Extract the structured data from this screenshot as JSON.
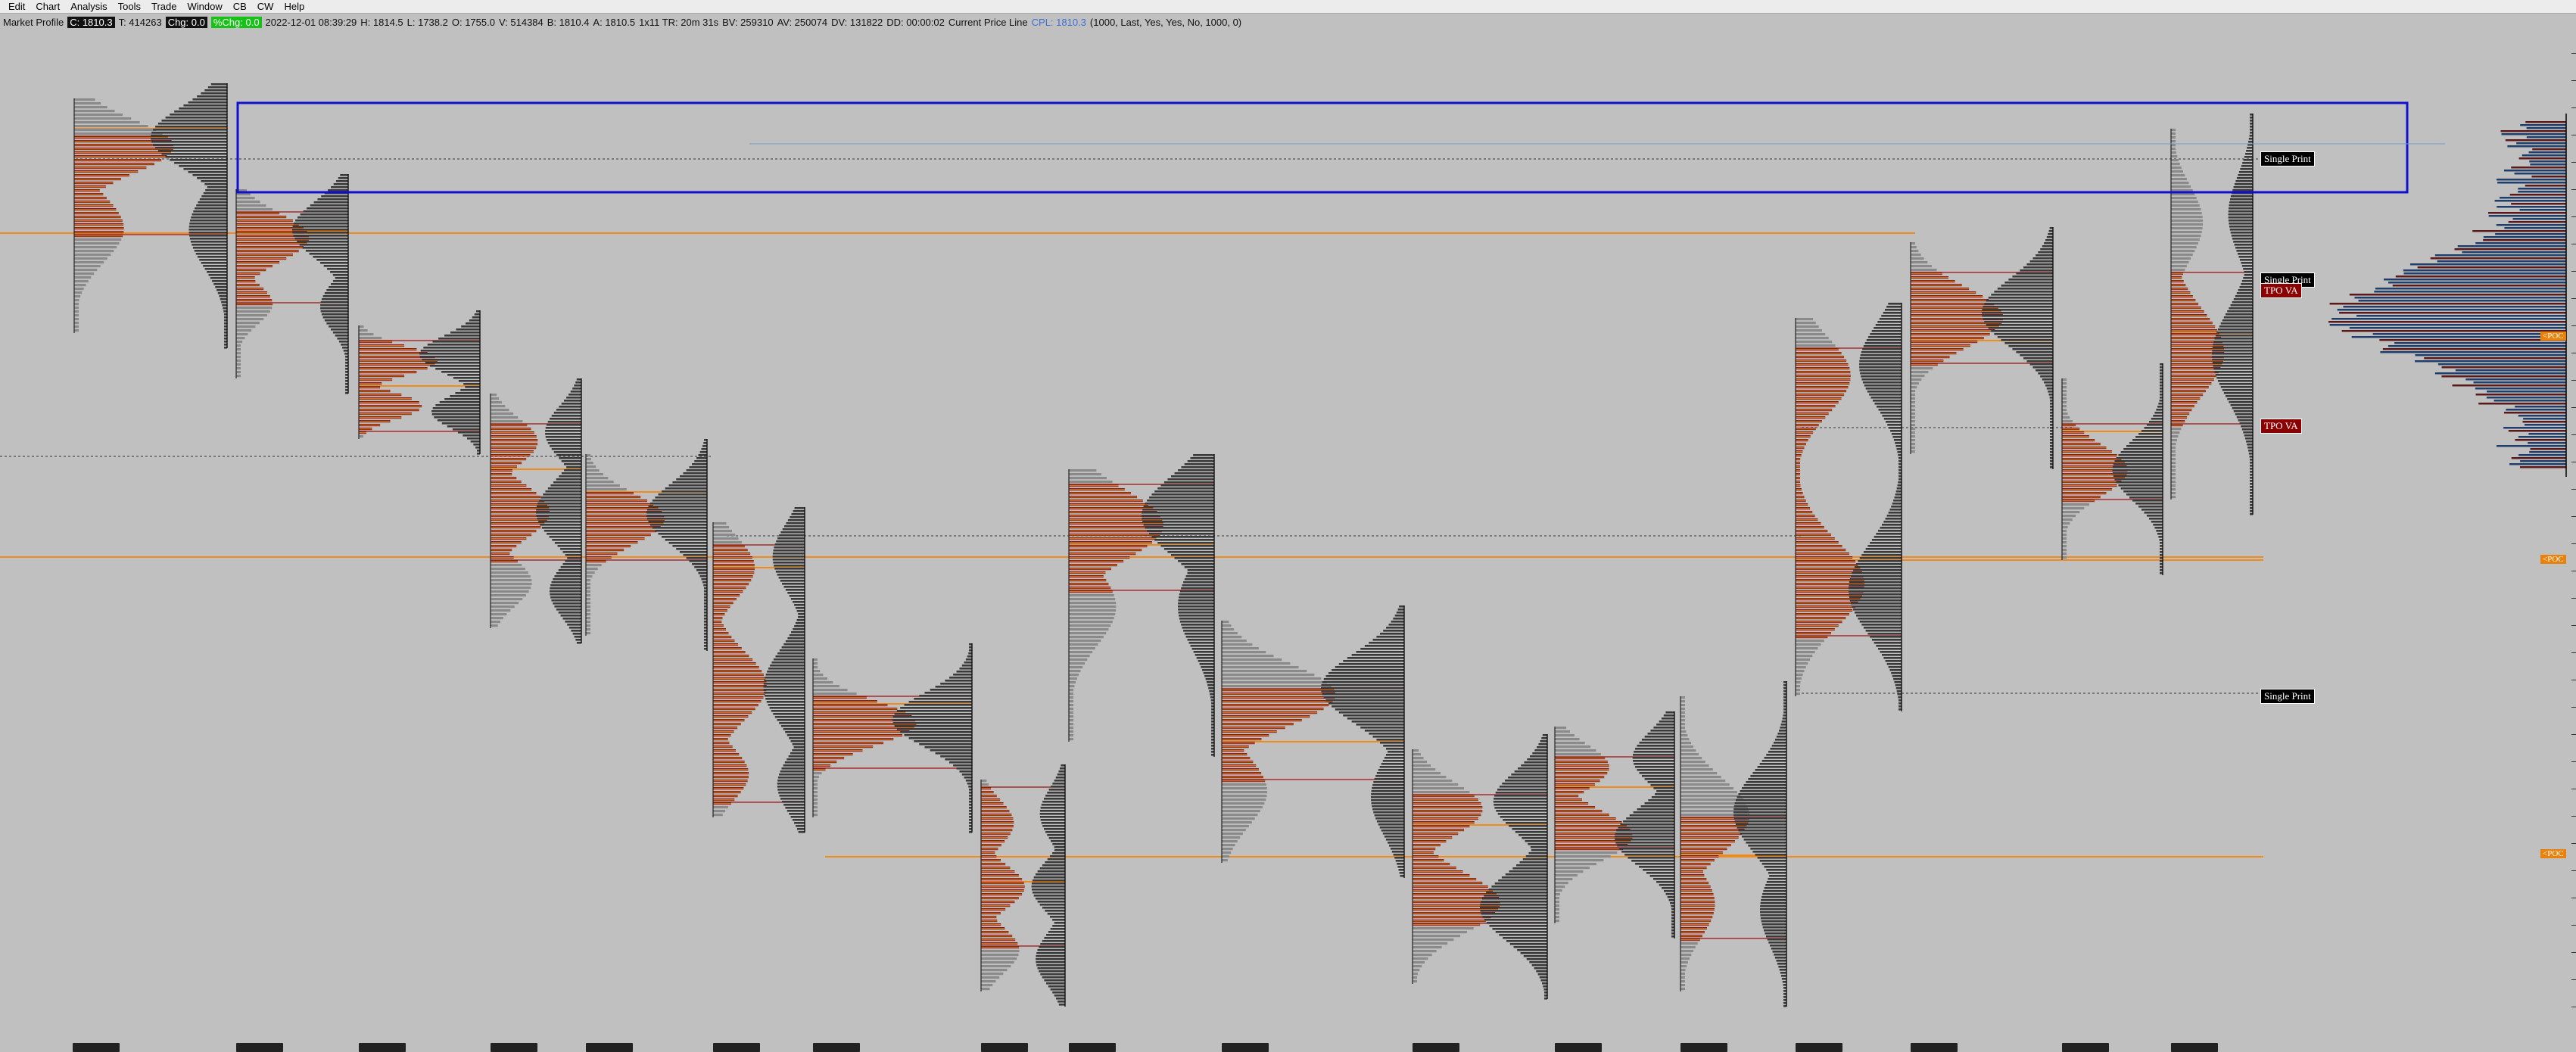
{
  "menu": {
    "items": [
      "Edit",
      "Chart",
      "Analysis",
      "Tools",
      "Trade",
      "Window",
      "CB",
      "CW",
      "Help"
    ]
  },
  "info": {
    "study": "Market Profile",
    "close": "C: 1810.3",
    "ticks": "T: 414263",
    "change": "Chg: 0.0",
    "change_pct": "%Chg: 0.0",
    "time": "2022-12-01 08:39:29",
    "high": "H: 1814.5",
    "low": "L: 1738.2",
    "open": "O: 1755.0",
    "volume": "V: 514384",
    "bid": "B: 1810.4",
    "ask": "A: 1810.5",
    "range": "1x11 TR: 20m 31s",
    "bv": "BV: 259310",
    "av": "AV: 250074",
    "dv": "DV: 131822",
    "dd": "DD: 00:00:02",
    "cpl_title": "Current Price Line",
    "cpl_value": "CPL: 1810.3",
    "params": "(1000, Last, Yes, Yes, No, 1000, 0)"
  },
  "labels": {
    "single_print": "Single Print",
    "tpo_va": "TPO VA",
    "poc": "<POC"
  },
  "colors": {
    "background": "#c0c0c0",
    "tpo_red": "#8b1a1a",
    "tpo_gray": "#8a8a8a",
    "volume_dark": "#3a3a3a",
    "poc_orange": "#f08a1a",
    "va_line": "#a01010",
    "selection_blue": "#1010d0",
    "volume_blue": "#1f3f6a"
  }
}
